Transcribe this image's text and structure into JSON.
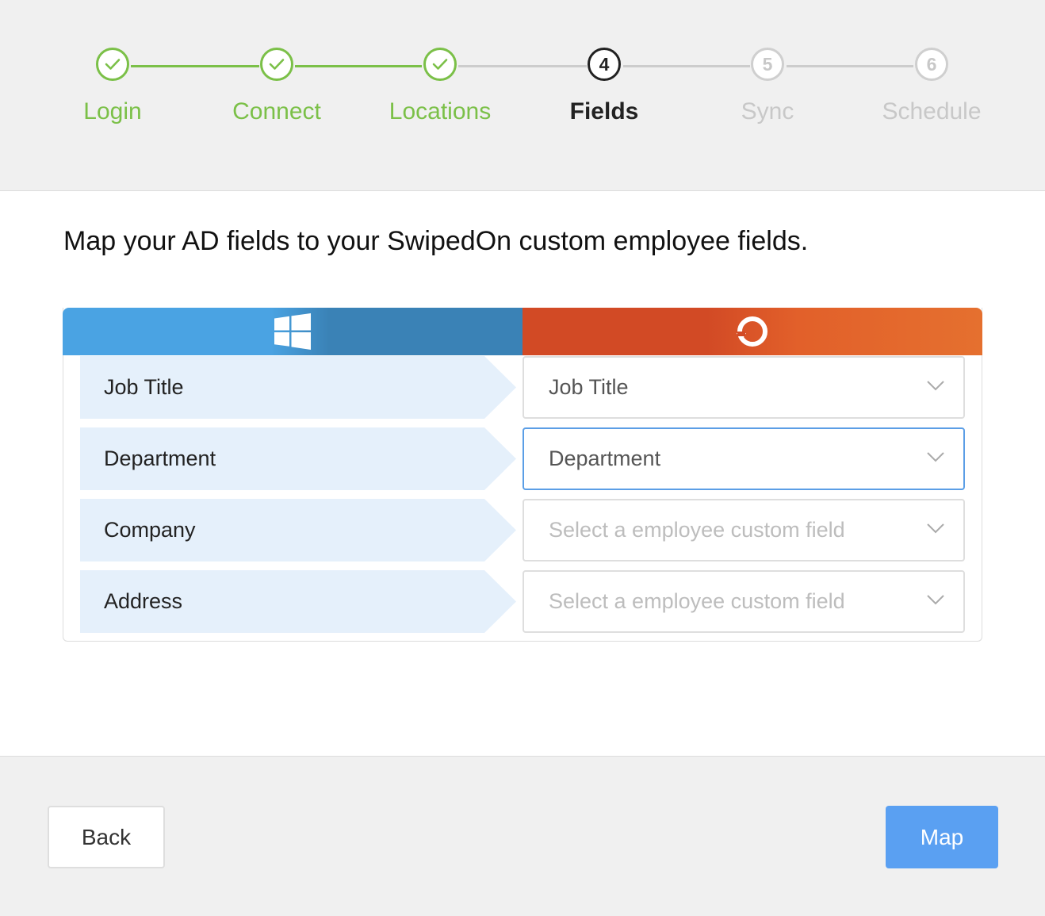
{
  "stepper": {
    "steps": [
      {
        "label": "Login",
        "status": "done",
        "marker": ""
      },
      {
        "label": "Connect",
        "status": "done",
        "marker": ""
      },
      {
        "label": "Locations",
        "status": "done",
        "marker": ""
      },
      {
        "label": "Fields",
        "status": "active",
        "marker": "4"
      },
      {
        "label": "Sync",
        "status": "pending",
        "marker": "5"
      },
      {
        "label": "Schedule",
        "status": "pending",
        "marker": "6"
      }
    ],
    "colors": {
      "done": "#7bc048",
      "active": "#222222",
      "pending": "#cfcfcf"
    }
  },
  "main": {
    "heading": "Map your AD fields to your SwipedOn custom employee fields."
  },
  "mapping": {
    "header_icons": {
      "left": "windows-logo-icon",
      "right": "swipedon-logo-icon"
    },
    "rows": [
      {
        "ad_field": "Job Title",
        "selected": "Job Title",
        "placeholder": false,
        "focused": false
      },
      {
        "ad_field": "Department",
        "selected": "Department",
        "placeholder": false,
        "focused": true
      },
      {
        "ad_field": "Company",
        "selected": "Select a employee custom field",
        "placeholder": true,
        "focused": false
      },
      {
        "ad_field": "Address",
        "selected": "Select a employee custom field",
        "placeholder": true,
        "focused": false
      }
    ]
  },
  "footer": {
    "back_label": "Back",
    "map_label": "Map"
  }
}
